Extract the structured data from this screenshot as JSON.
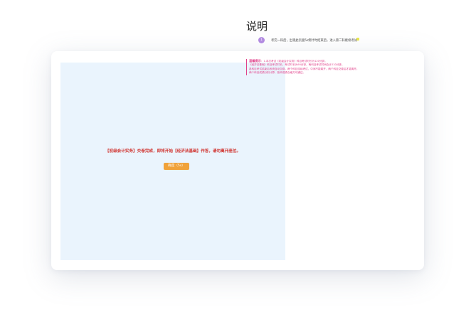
{
  "exam_notice": {
    "message": "【初级会计实务】交卷完成，即将开始【经济法基础】作答，请勿离开座位。",
    "confirm_label": "确定（5s）"
  },
  "instructions": {
    "title": "说明",
    "step_number": "1",
    "step_text": "考完一科后，出现此页面5s倒计时结束后，进入第二科继续考试",
    "tip_heading": "温馨提示",
    "tip_lines": [
      "：1.本次考试《初级会计实务》科目考试时长为120分钟，",
      "《经济法基础》科目考试时长，考试时长为90分钟，两科目考试时间合计210分钟。",
      "各科目考试结束后系统自动交卷，两个科目连续考试，中间不能离开，两个科目交卷后才能离开。",
      "两个科目成绩分别计算，各科成绩合格方可通过。"
    ]
  }
}
